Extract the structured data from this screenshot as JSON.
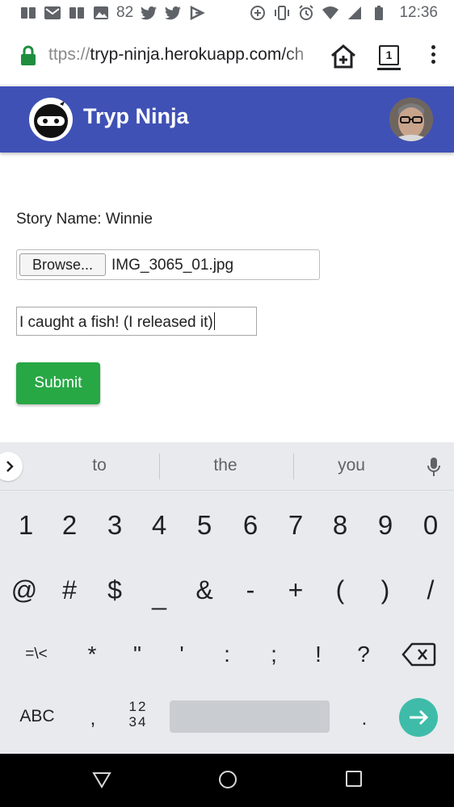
{
  "status_bar": {
    "left_icons": [
      "book-icon",
      "gmail-icon",
      "book-icon",
      "image-icon"
    ],
    "notification_count": "82",
    "more_icons": [
      "twitter-icon",
      "twitter-icon",
      "feedly-icon"
    ],
    "right_icons": [
      "data-saver-icon",
      "vibrate-icon",
      "alarm-icon",
      "wifi-icon",
      "signal-icon",
      "battery-icon"
    ],
    "time": "12:36"
  },
  "browser": {
    "url_scheme": "ttps://",
    "url_host": "tryp-ninja.herokuapp.com/ch",
    "tab_count": "1"
  },
  "app": {
    "title": "Tryp Ninja",
    "accent_color": "#3f51b5"
  },
  "form": {
    "story_label": "Story Name: Winnie",
    "browse_label": "Browse...",
    "file_name": "IMG_3065_01.jpg",
    "caption_value": "I caught a fish! (I released it)",
    "submit_label": "Submit",
    "submit_color": "#28a745"
  },
  "keyboard": {
    "suggestions": [
      "to",
      "the",
      "you"
    ],
    "number_row": [
      "1",
      "2",
      "3",
      "4",
      "5",
      "6",
      "7",
      "8",
      "9",
      "0"
    ],
    "symbol_row": [
      "@",
      "#",
      "$",
      "_",
      "&",
      "-",
      "+",
      "(",
      ")",
      "/"
    ],
    "symbol_row2": [
      "=\\<",
      "*",
      "\"",
      "'",
      ":",
      ";",
      "!",
      "?"
    ],
    "abc_label": "ABC",
    "comma_label": ",",
    "numpad_line1": "12",
    "numpad_line2": "34",
    "period_label": ".",
    "enter_color": "#3ebca9"
  }
}
